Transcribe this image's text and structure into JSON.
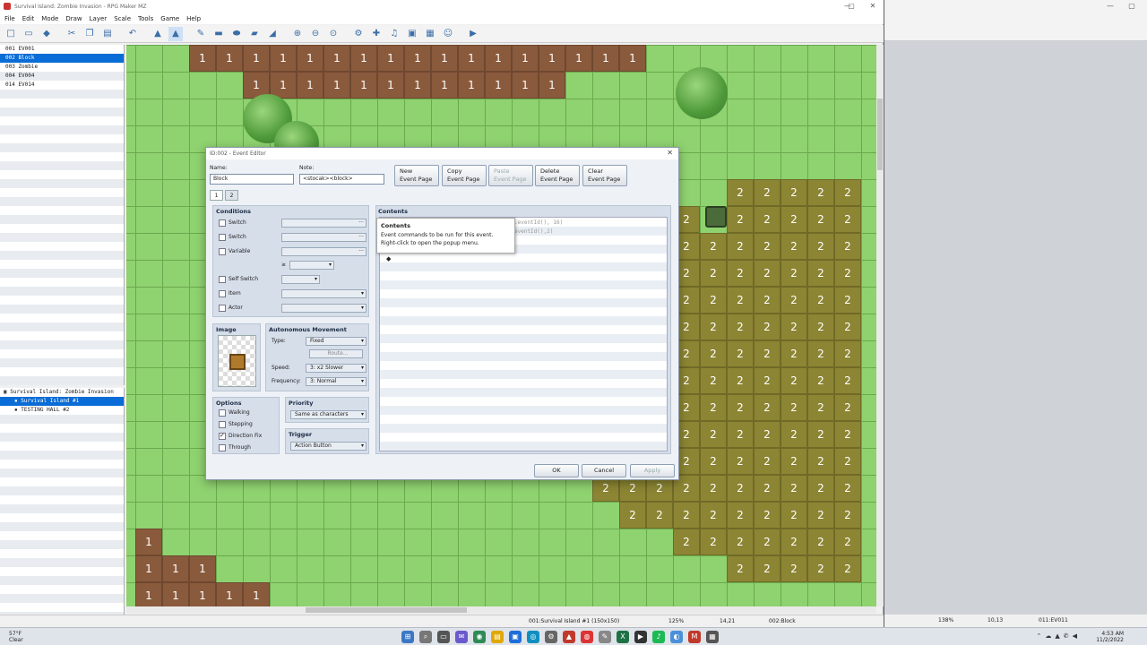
{
  "window": {
    "title": "Survival Island: Zombie Invasion - RPG Maker MZ",
    "min": "—",
    "max": "▢",
    "close": "✕"
  },
  "menu": [
    "File",
    "Edit",
    "Mode",
    "Draw",
    "Layer",
    "Scale",
    "Tools",
    "Game",
    "Help"
  ],
  "events": [
    {
      "label": "001 EV001",
      "selected": false
    },
    {
      "label": "002 Block",
      "selected": true
    },
    {
      "label": "003 Zombie",
      "selected": false
    },
    {
      "label": "004 EV004",
      "selected": false
    },
    {
      "label": "014 EV014",
      "selected": false
    }
  ],
  "maps": [
    {
      "label": "Survival Island: Zombie Invasion",
      "indent": false,
      "selected": false
    },
    {
      "label": "Survival Island #1",
      "indent": true,
      "selected": true
    },
    {
      "label": "TESTING HALL #2",
      "indent": true,
      "selected": false
    }
  ],
  "status": {
    "map": "001:Survival Island #1 (150x150)",
    "zoom": "125%",
    "coords": "14,21",
    "event": "002:Block"
  },
  "right_status": {
    "zoom": "138%",
    "coords": "10,13",
    "event": "011:EV011"
  },
  "taskbar": {
    "temp": "57°F",
    "weather": "Clear",
    "time": "4:53 AM",
    "date": "11/2/2022"
  },
  "dialog": {
    "title": "ID:002 - Event Editor",
    "name_label": "Name:",
    "name_value": "Block",
    "note_label": "Note:",
    "note_value": "<stocak><block>",
    "buttons": {
      "new": "New\nEvent Page",
      "copy": "Copy\nEvent Page",
      "paste": "Paste\nEvent Page",
      "delete": "Delete\nEvent Page",
      "clear": "Clear\nEvent Page"
    },
    "tabs": [
      "1",
      "2"
    ],
    "conditions": {
      "header": "Conditions",
      "switch1": "Switch",
      "switch2": "Switch",
      "variable": "Variable",
      "self_switch": "Self Switch",
      "item": "Item",
      "actor": "Actor",
      "ge": "≥"
    },
    "image_header": "Image",
    "movement": {
      "header": "Autonomous Movement",
      "type_label": "Type:",
      "type": "Fixed",
      "route": "Route...",
      "speed_label": "Speed:",
      "speed": "3: x2 Slower",
      "freq_label": "Frequency:",
      "freq": "3: Normal"
    },
    "options": {
      "header": "Options",
      "walking": "Walking",
      "stepping": "Stepping",
      "direction_fix": "Direction Fix",
      "through": "Through"
    },
    "priority": {
      "header": "Priority",
      "value": "Same as characters"
    },
    "trigger": {
      "header": "Trigger",
      "value": "Action Button"
    },
    "contents_header": "Contents",
    "tooltip_title": "Contents",
    "tooltip_body": "Event commands to be run for this event. Right-click to open the popup menu.",
    "ghost1": ".eventId(), 16)",
    "ghost2": "eventId(),2)",
    "bullet": "◆",
    "ok": "OK",
    "cancel": "Cancel",
    "apply": "Apply"
  },
  "tile_labels": {
    "one": "1",
    "two": "2"
  },
  "colors": {
    "accent": "#0a6cd6",
    "grass": "#8fd270",
    "tile1": "#8a5a3c",
    "tile2": "#8c8533"
  }
}
